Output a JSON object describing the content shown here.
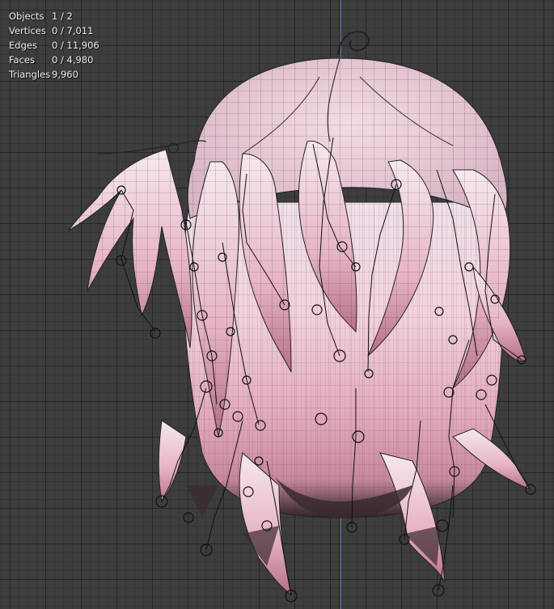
{
  "viewport": {
    "axis_color": "#5a7fd0",
    "background_color": "#3d3d3d"
  },
  "stats": [
    {
      "label": "Objects",
      "value": "1 / 2"
    },
    {
      "label": "Vertices",
      "value": "0 / 7,011"
    },
    {
      "label": "Edges",
      "value": "0 / 11,906"
    },
    {
      "label": "Faces",
      "value": "0 / 4,980"
    },
    {
      "label": "Triangles",
      "value": "9,960"
    }
  ],
  "model": {
    "hair_colors": [
      "#f4dde6",
      "#e8b7c8",
      "#d98fa9",
      "#3a2a2e"
    ]
  }
}
